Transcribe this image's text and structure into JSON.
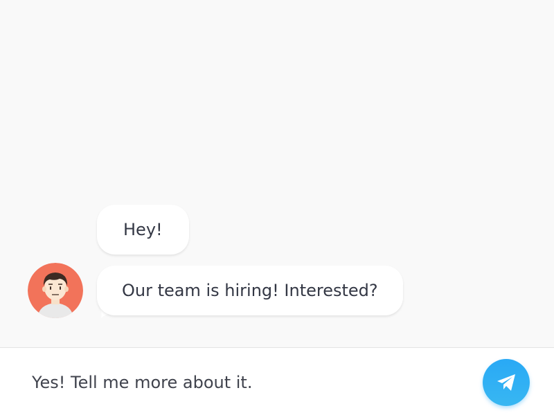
{
  "conversation": {
    "messages": [
      {
        "sender": "incoming",
        "text": "Hey!"
      },
      {
        "sender": "incoming",
        "text": "Our team is hiring! Interested?"
      }
    ],
    "avatar_icon": "person-avatar-icon"
  },
  "composer": {
    "text": "Yes! Tell me more about it.",
    "send_icon": "paper-plane-icon"
  },
  "colors": {
    "background": "#f9f9f9",
    "bubble": "#ffffff",
    "text": "#333744",
    "send_button": "#29a9f5",
    "avatar_background": "#f2735a"
  }
}
